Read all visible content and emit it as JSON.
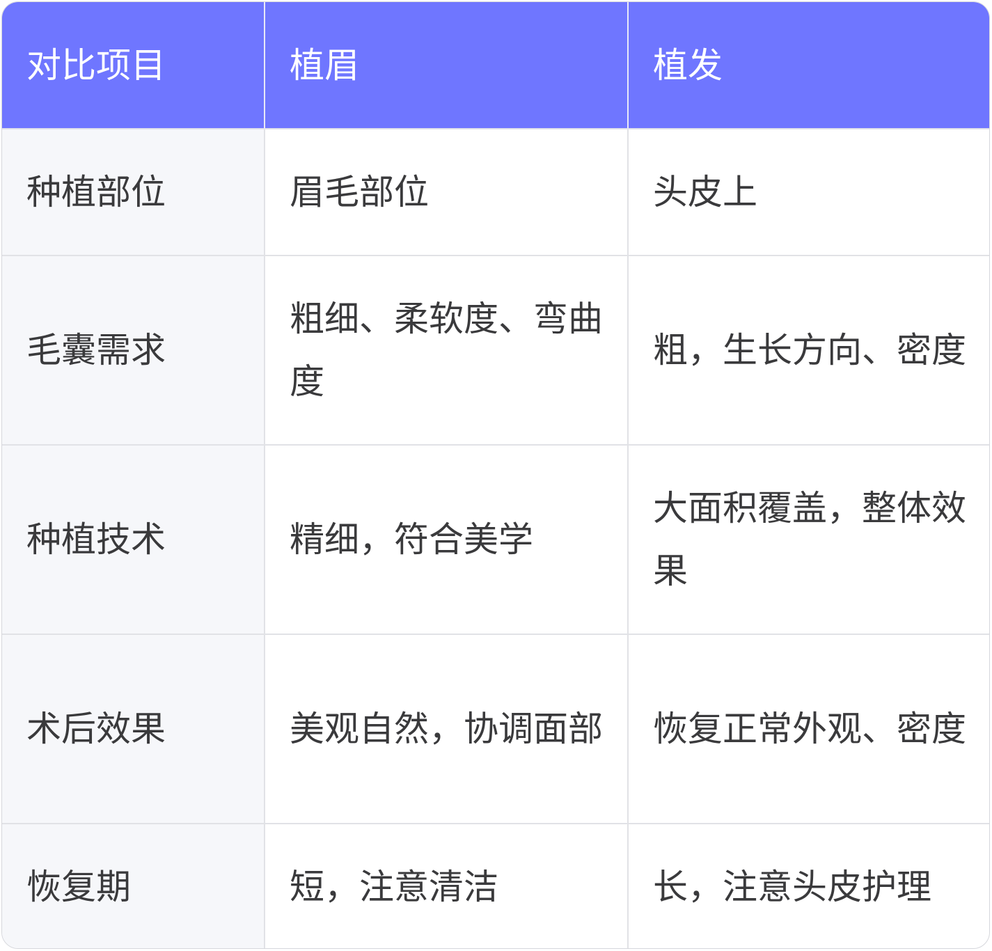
{
  "table": {
    "headers": [
      "对比项目",
      "植眉",
      "植发"
    ],
    "rows": [
      {
        "item": "种植部位",
        "eyebrow": "眉毛部位",
        "hair": "头皮上"
      },
      {
        "item": "毛囊需求",
        "eyebrow": "粗细、柔软度、弯曲度",
        "hair": "粗，生长方向、密度"
      },
      {
        "item": "种植技术",
        "eyebrow": "精细，符合美学",
        "hair": "大面积覆盖，整体效果"
      },
      {
        "item": "术后效果",
        "eyebrow": "美观自然，协调面部",
        "hair": "恢复正常外观、密度"
      },
      {
        "item": "恢复期",
        "eyebrow": "短，注意清洁",
        "hair": "长，注意头皮护理"
      }
    ]
  },
  "colors": {
    "header_bg": "#6f76ff",
    "header_text": "#ffffff",
    "label_bg": "#f6f7fa",
    "body_text": "#3a3a3c",
    "border": "#e1e2e6"
  }
}
